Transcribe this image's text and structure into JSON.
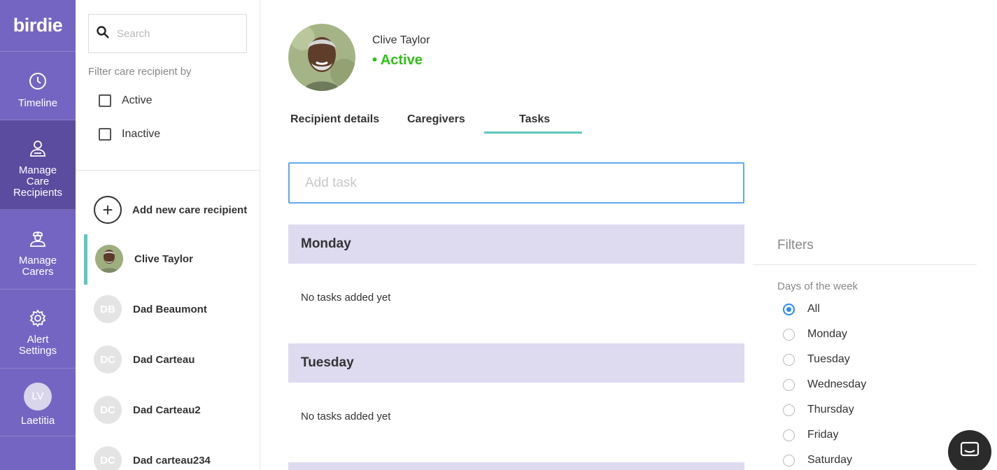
{
  "brand": {
    "logo": "birdie"
  },
  "nav": {
    "timeline": "Timeline",
    "manage_recipients_line1": "Manage",
    "manage_recipients_line2": "Care",
    "manage_recipients_line3": "Recipients",
    "manage_carers_line1": "Manage",
    "manage_carers_line2": "Carers",
    "alert_line1": "Alert",
    "alert_line2": "Settings",
    "user_initials": "LV",
    "user_name": "Laetitia"
  },
  "sidebar": {
    "search_placeholder": "Search",
    "filter_label": "Filter care recipient by",
    "filters": [
      "Active",
      "Inactive"
    ],
    "add_new": "Add new care recipient",
    "recipients": [
      {
        "initials": "",
        "name": "Clive Taylor"
      },
      {
        "initials": "DB",
        "name": "Dad Beaumont"
      },
      {
        "initials": "DC",
        "name": "Dad Carteau"
      },
      {
        "initials": "DC",
        "name": "Dad Carteau2"
      },
      {
        "initials": "DC",
        "name": "Dad carteau234"
      }
    ]
  },
  "profile": {
    "name": "Clive Taylor",
    "status": "• Active"
  },
  "tabs": [
    "Recipient details",
    "Caregivers",
    "Tasks"
  ],
  "task_input": {
    "placeholder": "Add task",
    "value": ""
  },
  "days": [
    {
      "name": "Monday",
      "empty": "No tasks added yet"
    },
    {
      "name": "Tuesday",
      "empty": "No tasks added yet"
    }
  ],
  "filters_panel": {
    "title": "Filters",
    "days_label": "Days of the week",
    "options": [
      "All",
      "Monday",
      "Tuesday",
      "Wednesday",
      "Thursday",
      "Friday",
      "Saturday"
    ],
    "selected": "All"
  },
  "colors": {
    "nav_bg": "#7565c2",
    "nav_active": "#5b4c9f",
    "accent_teal": "#5ec7c0",
    "status_green": "#2ec016",
    "day_header": "#dedaf0",
    "focus_blue": "#62a8ea"
  },
  "icons": {
    "search": "search-icon",
    "timeline": "clock-icon",
    "recipients": "person-icon",
    "carers": "nurse-icon",
    "alerts": "gear-icon",
    "add": "plus-icon",
    "chat": "chat-icon"
  }
}
